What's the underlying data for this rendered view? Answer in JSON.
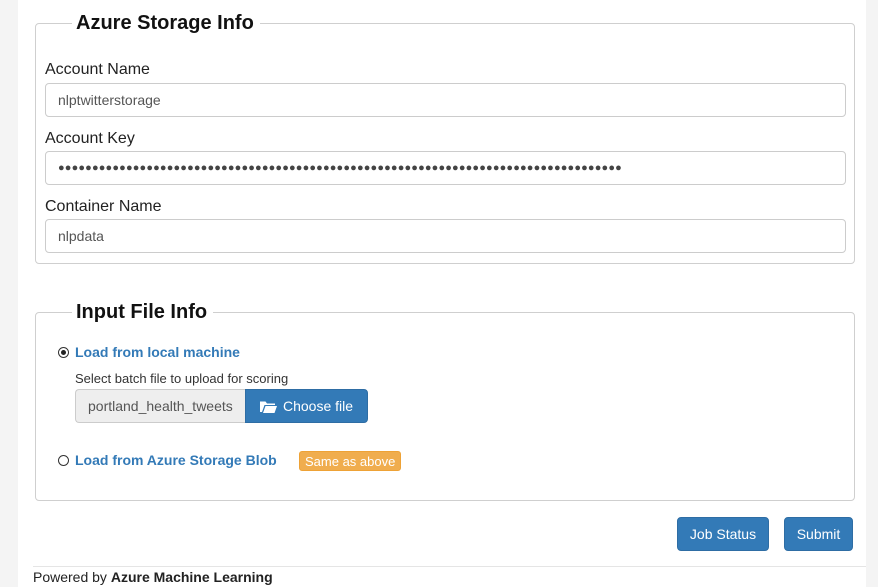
{
  "storage": {
    "title": "Azure Storage Info",
    "account_name_label": "Account Name",
    "account_name_value": "nlptwitterstorage",
    "account_key_label": "Account Key",
    "account_key_value": "●●●●●●●●●●●●●●●●●●●●●●●●●●●●●●●●●●●●●●●●●●●●●●●●●●●●●●●●●●●●●●●●●●●●●●●●●●●●●●●●●●●",
    "container_name_label": "Container Name",
    "container_name_value": "nlpdata"
  },
  "input": {
    "title": "Input File Info",
    "local_option_label": "Load from local machine",
    "local_option_checked": true,
    "batch_hint": "Select batch file to upload for scoring",
    "selected_file": "portland_health_tweets",
    "choose_file_label": "Choose file",
    "blob_option_label": "Load from Azure Storage Blob",
    "blob_option_checked": false,
    "same_as_above_badge": "Same as above"
  },
  "actions": {
    "job_status_label": "Job Status",
    "submit_label": "Submit"
  },
  "footer": {
    "prefix": "Powered by ",
    "brand": "Azure Machine Learning"
  },
  "colors": {
    "primary": "#337ab7",
    "warning": "#f0ad4e"
  }
}
